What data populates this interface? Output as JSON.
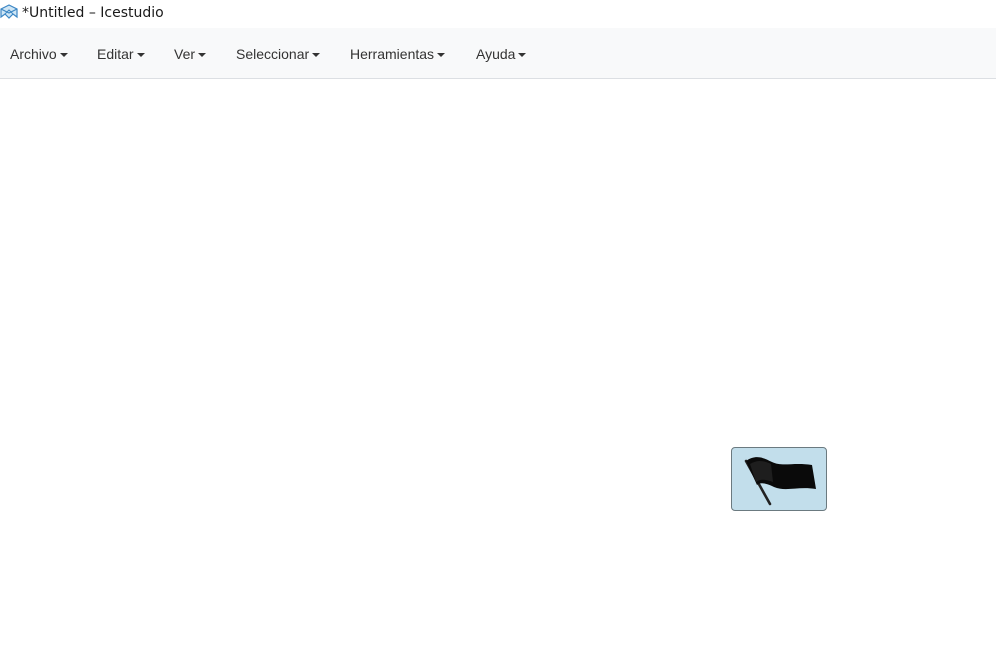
{
  "window": {
    "title": "*Untitled – Icestudio",
    "icon": "icestudio-logo-icon"
  },
  "menubar": {
    "items": [
      {
        "label": "Archivo"
      },
      {
        "label": "Editar"
      },
      {
        "label": "Ver"
      },
      {
        "label": "Seleccionar"
      },
      {
        "label": "Herramientas"
      },
      {
        "label": "Ayuda"
      }
    ]
  },
  "canvas": {
    "blocks": [
      {
        "icon": "black-flag-icon",
        "color": "#c2deeb"
      }
    ]
  },
  "colors": {
    "menubar_bg": "#f8f9fa",
    "block_fill": "#c2deeb",
    "logo_blue": "#3b86c4"
  }
}
